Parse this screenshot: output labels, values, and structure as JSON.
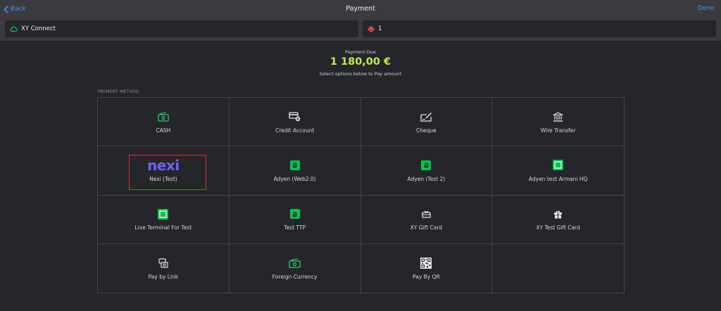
{
  "header": {
    "back_label": "Back",
    "title": "Payment",
    "done_label": "Done"
  },
  "status": {
    "connection_label": "XY Connect",
    "printer_value": "1"
  },
  "payment": {
    "due_label": "Payment Due",
    "amount": "1 180,00 €",
    "hint": "Select options below to Pay amount",
    "section_label": "PAYMENT METHOD"
  },
  "methods": [
    {
      "label": "CASH",
      "icon": "cash-icon"
    },
    {
      "label": "Credit Account",
      "icon": "credit-account-icon"
    },
    {
      "label": "Cheque",
      "icon": "cheque-icon"
    },
    {
      "label": "Wire Transfer",
      "icon": "bank-icon"
    },
    {
      "label": "Nexi (Test)",
      "icon": "nexi-logo",
      "logo_text": "nexi",
      "selected": true
    },
    {
      "label": "Adyen (Web2.0)",
      "icon": "adyen-icon"
    },
    {
      "label": "Adyen (Test 2)",
      "icon": "adyen-icon"
    },
    {
      "label": "Adyen test Armani HQ",
      "icon": "terminal-icon"
    },
    {
      "label": "Live Terminal For Test",
      "icon": "terminal-icon"
    },
    {
      "label": "Test TTP",
      "icon": "adyen-icon"
    },
    {
      "label": "XY Gift Card",
      "icon": "gift-card-icon"
    },
    {
      "label": "XY Test Gift Card",
      "icon": "gift-icon"
    },
    {
      "label": "Pay by Link",
      "icon": "pay-by-link-icon"
    },
    {
      "label": "Foreign Currency",
      "icon": "foreign-currency-icon"
    },
    {
      "label": "Pay By QR",
      "icon": "qr-code-icon"
    }
  ],
  "colors": {
    "accent": "#4a90e2",
    "amount": "#c7e84a",
    "green_icon": "#2ecc71",
    "adyen": "#0abf53",
    "nexi": "#6f63ee",
    "selection": "#d9342b",
    "printer": "#e04848"
  }
}
